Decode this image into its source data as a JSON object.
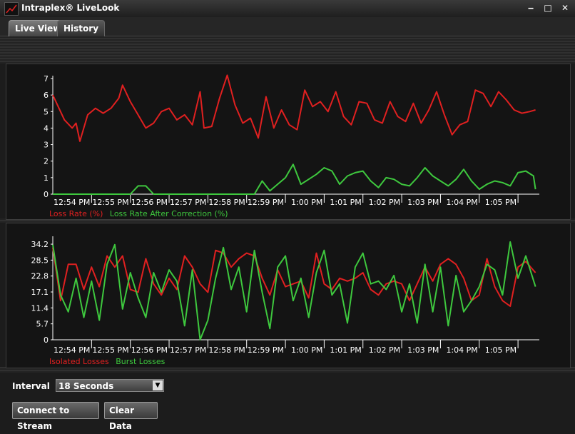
{
  "window": {
    "title": "Intraplex® LiveLook",
    "controls": [
      "‒",
      "□",
      "✕"
    ]
  },
  "tabs": [
    {
      "label": "Live View",
      "active": true
    },
    {
      "label": "History",
      "active": false
    }
  ],
  "colors": {
    "red": "#e02020",
    "green": "#3ec83e"
  },
  "chart_data": [
    {
      "type": "line",
      "title": "",
      "xlabel": "",
      "ylabel": "",
      "ylim": [
        0,
        7
      ],
      "yticks": [
        "0",
        "1",
        "2",
        "3",
        "4",
        "5",
        "6",
        "7"
      ],
      "categories": [
        "12:54 PM",
        "12:55 PM",
        "12:56 PM",
        "12:57 PM",
        "12:58 PM",
        "12:59 PM",
        "1:00 PM",
        "1:01 PM",
        "1:02 PM",
        "1:03 PM",
        "1:04 PM",
        "1:05 PM"
      ],
      "x_range": [
        0,
        12.55
      ],
      "series": [
        {
          "name": "Loss Rate (%)",
          "color": "#e02020",
          "x": [
            0,
            0.1,
            0.3,
            0.5,
            0.6,
            0.7,
            0.9,
            1.1,
            1.3,
            1.5,
            1.7,
            1.8,
            2.0,
            2.2,
            2.4,
            2.6,
            2.8,
            3.0,
            3.2,
            3.4,
            3.6,
            3.8,
            3.9,
            4.1,
            4.3,
            4.5,
            4.7,
            4.9,
            5.1,
            5.3,
            5.5,
            5.7,
            5.9,
            6.1,
            6.3,
            6.5,
            6.7,
            6.9,
            7.1,
            7.3,
            7.5,
            7.7,
            7.9,
            8.1,
            8.3,
            8.5,
            8.7,
            8.9,
            9.1,
            9.3,
            9.5,
            9.7,
            9.9,
            10.1,
            10.3,
            10.5,
            10.7,
            10.9,
            11.1,
            11.3,
            11.5,
            11.7,
            11.9,
            12.1,
            12.3,
            12.45
          ],
          "values": [
            6.0,
            5.5,
            4.5,
            4.0,
            4.3,
            3.2,
            4.8,
            5.2,
            4.9,
            5.2,
            5.8,
            6.6,
            5.6,
            4.8,
            4.0,
            4.3,
            5.0,
            5.2,
            4.5,
            4.8,
            4.2,
            6.2,
            4.0,
            4.1,
            5.8,
            7.2,
            5.4,
            4.3,
            4.6,
            3.4,
            5.9,
            4.0,
            5.1,
            4.2,
            3.9,
            6.3,
            5.3,
            5.6,
            5.0,
            6.2,
            4.7,
            4.2,
            5.6,
            5.5,
            4.5,
            4.3,
            5.6,
            4.7,
            4.4,
            5.5,
            4.3,
            5.1,
            6.2,
            4.8,
            3.6,
            4.2,
            4.4,
            6.3,
            6.1,
            5.3,
            6.2,
            5.7,
            5.1,
            4.9,
            5.0,
            5.1
          ]
        },
        {
          "name": "Loss Rate After Correction (%)",
          "color": "#3ec83e",
          "x": [
            0,
            0.5,
            1.0,
            1.5,
            2.0,
            2.2,
            2.4,
            2.6,
            2.8,
            3.0,
            3.5,
            4.0,
            4.5,
            5.0,
            5.2,
            5.4,
            5.6,
            5.8,
            6.0,
            6.2,
            6.4,
            6.6,
            6.8,
            7.0,
            7.2,
            7.4,
            7.6,
            7.8,
            8.0,
            8.2,
            8.4,
            8.6,
            8.8,
            9.0,
            9.2,
            9.4,
            9.6,
            9.8,
            10.0,
            10.2,
            10.4,
            10.6,
            10.8,
            11.0,
            11.2,
            11.4,
            11.6,
            11.8,
            12.0,
            12.2,
            12.4,
            12.45
          ],
          "values": [
            0,
            0,
            0,
            0,
            0,
            0.5,
            0.5,
            0,
            0,
            0,
            0,
            0,
            0,
            0,
            0,
            0.8,
            0.2,
            0.6,
            1.0,
            1.8,
            0.6,
            0.9,
            1.2,
            1.6,
            1.4,
            0.6,
            1.1,
            1.3,
            1.4,
            0.8,
            0.4,
            1.0,
            0.9,
            0.6,
            0.5,
            1.0,
            1.6,
            1.1,
            0.8,
            0.5,
            0.9,
            1.5,
            0.8,
            0.3,
            0.6,
            0.8,
            0.7,
            0.5,
            1.3,
            1.4,
            1.1,
            0.3
          ]
        }
      ]
    },
    {
      "type": "line",
      "title": "",
      "xlabel": "",
      "ylabel": "",
      "ylim": [
        0,
        36
      ],
      "yticks": [
        "0",
        "5.7",
        "11.4",
        "17.1",
        "22.8",
        "28.5",
        "34.2"
      ],
      "ytick_values": [
        0,
        5.7,
        11.4,
        17.1,
        22.8,
        28.5,
        34.2
      ],
      "categories": [
        "12:54 PM",
        "12:55 PM",
        "12:56 PM",
        "12:57 PM",
        "12:58 PM",
        "12:59 PM",
        "1:00 PM",
        "1:01 PM",
        "1:02 PM",
        "1:03 PM",
        "1:04 PM",
        "1:05 PM"
      ],
      "x_range": [
        0,
        12.55
      ],
      "series": [
        {
          "name": "Isolated Losses",
          "color": "#e02020",
          "x": [
            0,
            0.2,
            0.4,
            0.6,
            0.8,
            1.0,
            1.2,
            1.4,
            1.6,
            1.8,
            2.0,
            2.2,
            2.4,
            2.6,
            2.8,
            3.0,
            3.2,
            3.4,
            3.6,
            3.8,
            4.0,
            4.2,
            4.4,
            4.6,
            4.8,
            5.0,
            5.2,
            5.4,
            5.6,
            5.8,
            6.0,
            6.2,
            6.4,
            6.6,
            6.8,
            7.0,
            7.2,
            7.4,
            7.6,
            7.8,
            8.0,
            8.2,
            8.4,
            8.6,
            8.8,
            9.0,
            9.2,
            9.4,
            9.6,
            9.8,
            10.0,
            10.2,
            10.4,
            10.6,
            10.8,
            11.0,
            11.2,
            11.4,
            11.6,
            11.8,
            12.0,
            12.2,
            12.45
          ],
          "values": [
            33,
            14,
            27,
            27,
            18,
            26,
            19,
            30,
            26,
            30,
            18,
            17,
            29,
            20,
            16,
            22,
            18,
            30,
            26,
            20,
            17,
            32,
            31,
            26,
            29,
            31,
            30,
            22,
            16,
            25,
            19,
            20,
            21,
            15,
            31,
            20,
            18,
            22,
            21,
            22,
            24,
            18,
            16,
            20,
            21,
            20,
            14,
            20,
            26,
            21,
            27,
            29,
            27,
            22,
            14,
            16,
            29,
            19,
            14,
            12,
            26,
            28,
            24
          ]
        },
        {
          "name": "Burst Losses",
          "color": "#3ec83e",
          "x": [
            0,
            0.2,
            0.4,
            0.6,
            0.8,
            1.0,
            1.2,
            1.4,
            1.6,
            1.8,
            2.0,
            2.2,
            2.4,
            2.6,
            2.8,
            3.0,
            3.2,
            3.4,
            3.6,
            3.8,
            4.0,
            4.2,
            4.4,
            4.6,
            4.8,
            5.0,
            5.2,
            5.4,
            5.6,
            5.8,
            6.0,
            6.2,
            6.4,
            6.6,
            6.8,
            7.0,
            7.2,
            7.4,
            7.6,
            7.8,
            8.0,
            8.2,
            8.4,
            8.6,
            8.8,
            9.0,
            9.2,
            9.4,
            9.6,
            9.8,
            10.0,
            10.2,
            10.4,
            10.6,
            10.8,
            11.0,
            11.2,
            11.4,
            11.6,
            11.8,
            12.0,
            12.2,
            12.45
          ],
          "values": [
            34,
            16,
            10,
            22,
            8,
            21,
            7,
            27,
            34,
            11,
            24,
            15,
            8,
            24,
            17,
            25,
            21,
            5,
            25,
            0,
            7,
            22,
            33,
            18,
            26,
            10,
            32,
            17,
            4,
            26,
            30,
            14,
            22,
            8,
            24,
            32,
            16,
            20,
            6,
            26,
            31,
            20,
            21,
            18,
            23,
            10,
            20,
            6,
            27,
            10,
            26,
            5,
            23,
            10,
            14,
            19,
            27,
            25,
            16,
            35,
            22,
            30,
            19
          ]
        }
      ]
    }
  ],
  "controls": {
    "interval_label": "Interval",
    "interval_value": "18 Seconds",
    "connect_label": "Connect to Stream",
    "clear_label": "Clear Data"
  }
}
